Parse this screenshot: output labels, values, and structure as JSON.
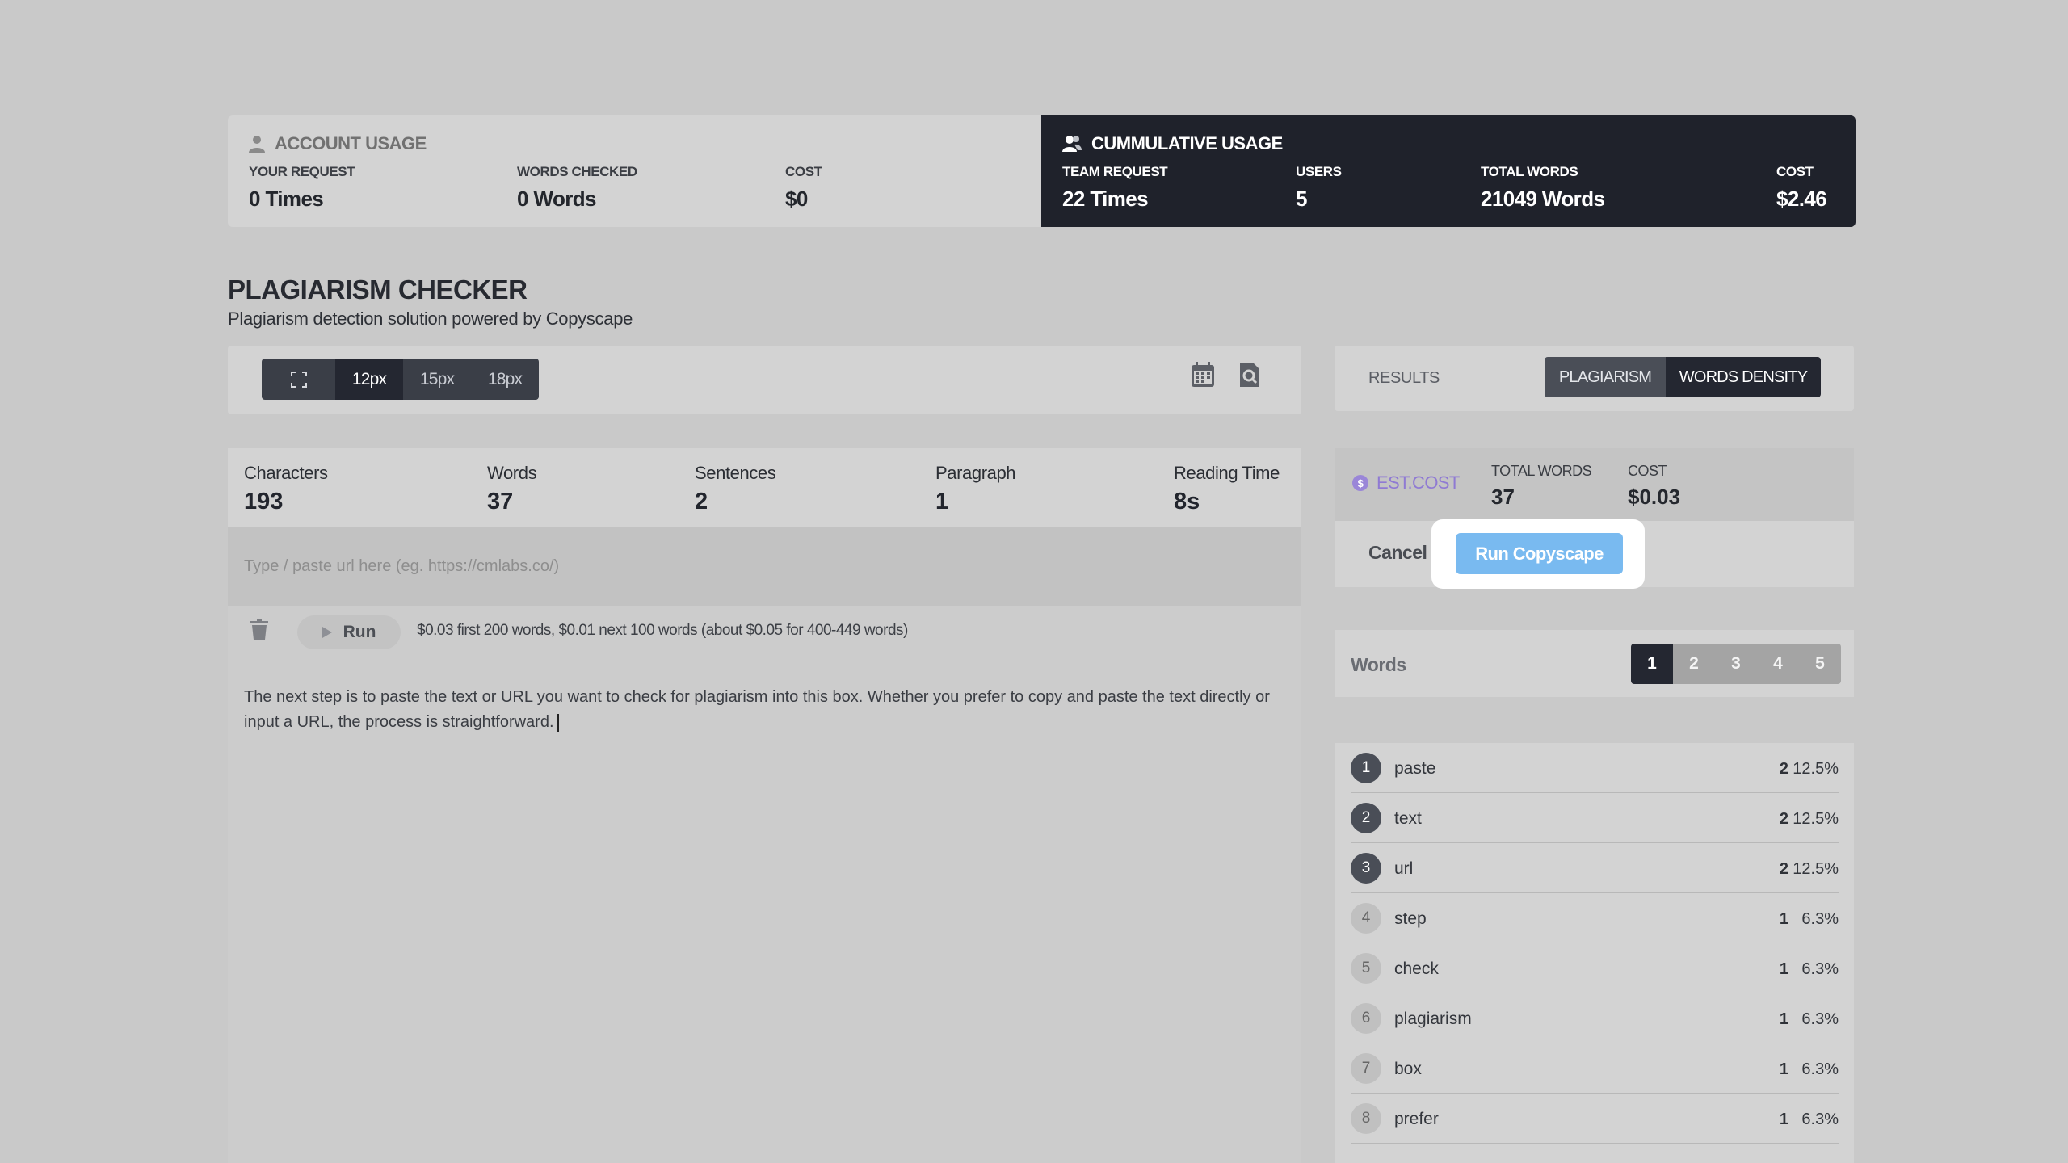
{
  "account_usage": {
    "title": "ACCOUNT USAGE",
    "icon": "user-icon",
    "your_request_label": "YOUR REQUEST",
    "your_request_value": "0 Times",
    "words_checked_label": "WORDS CHECKED",
    "words_checked_value": "0 Words",
    "cost_label": "COST",
    "cost_value": "$0"
  },
  "cumulative_usage": {
    "title": "CUMMULATIVE USAGE",
    "icon": "users-icon",
    "team_request_label": "TEAM REQUEST",
    "team_request_value": "22 Times",
    "users_label": "USERS",
    "users_value": "5",
    "total_words_label": "TOTAL WORDS",
    "total_words_value": "21049 Words",
    "cost_label": "COST",
    "cost_value": "$2.46"
  },
  "page": {
    "title": "PLAGIARISM CHECKER",
    "subtitle": "Plagiarism detection solution powered by Copyscape"
  },
  "toolbar": {
    "font_sizes": [
      "12px",
      "15px",
      "18px"
    ],
    "active_font_size": "12px"
  },
  "stats": {
    "characters_label": "Characters",
    "characters_value": "193",
    "words_label": "Words",
    "words_value": "37",
    "sentences_label": "Sentences",
    "sentences_value": "2",
    "paragraph_label": "Paragraph",
    "paragraph_value": "1",
    "reading_time_label": "Reading Time",
    "reading_time_value": "8s"
  },
  "url_input": {
    "placeholder": "Type / paste url here (eg. https://cmlabs.co/)",
    "value": ""
  },
  "editor": {
    "run_label": "Run",
    "price_note": "$0.03 first 200 words, $0.01 next 100 words (about $0.05 for 400-449 words)",
    "text": "The next step is to paste the text or URL you want to check for plagiarism into this box. Whether you prefer to copy and paste the text directly or input a URL, the process is straightforward."
  },
  "results": {
    "label": "RESULTS",
    "tabs": [
      "PLAGIARISM",
      "WORDS DENSITY"
    ],
    "active_tab": "WORDS DENSITY"
  },
  "estimate": {
    "label": "EST.COST",
    "total_words_label": "TOTAL WORDS",
    "total_words_value": "37",
    "cost_label": "COST",
    "cost_value": "$0.03"
  },
  "actions": {
    "cancel_label": "Cancel",
    "run_label": "Run Copyscape"
  },
  "words_density": {
    "label": "Words",
    "ngrams": [
      "1",
      "2",
      "3",
      "4",
      "5"
    ],
    "active_ngram": "1",
    "rows": [
      {
        "rank": "1",
        "word": "paste",
        "count": "2",
        "pct": "12.5%"
      },
      {
        "rank": "2",
        "word": "text",
        "count": "2",
        "pct": "12.5%"
      },
      {
        "rank": "3",
        "word": "url",
        "count": "2",
        "pct": "12.5%"
      },
      {
        "rank": "4",
        "word": "step",
        "count": "1",
        "pct": "6.3%"
      },
      {
        "rank": "5",
        "word": "check",
        "count": "1",
        "pct": "6.3%"
      },
      {
        "rank": "6",
        "word": "plagiarism",
        "count": "1",
        "pct": "6.3%"
      },
      {
        "rank": "7",
        "word": "box",
        "count": "1",
        "pct": "6.3%"
      },
      {
        "rank": "8",
        "word": "prefer",
        "count": "1",
        "pct": "6.3%"
      }
    ]
  }
}
